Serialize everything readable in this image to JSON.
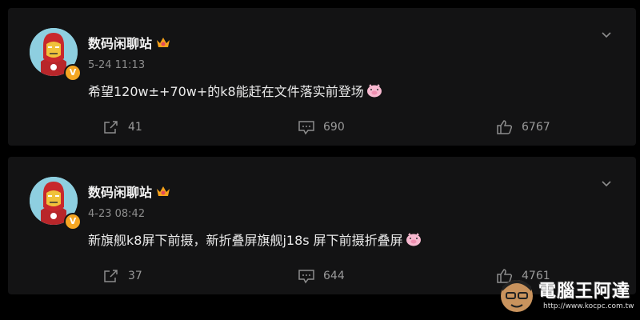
{
  "posts": [
    {
      "author": "数码闲聊站",
      "timestamp": "5-24 11:13",
      "content": "希望120w±+70w+的k8能赶在文件落实前登场",
      "reposts": "41",
      "comments": "690",
      "likes": "6767"
    },
    {
      "author": "数码闲聊站",
      "timestamp": "4-23 08:42",
      "content": "新旗舰k8屏下前摄，新折叠屏旗舰j18s 屏下前摄折叠屏",
      "reposts": "37",
      "comments": "644",
      "likes": "4761"
    }
  ],
  "watermark": {
    "title": "電腦王阿達",
    "url": "http://www.kocpc.com.tw"
  },
  "colors": {
    "background": "#000000",
    "card": "#131314",
    "badge": "#f5a623",
    "muted": "#8d8d8d"
  },
  "icons": [
    "avatar-ironman",
    "verified-badge-icon",
    "crown-icon",
    "pig-emoji-icon",
    "chevron-down-icon",
    "repost-icon",
    "comment-icon",
    "like-icon"
  ]
}
